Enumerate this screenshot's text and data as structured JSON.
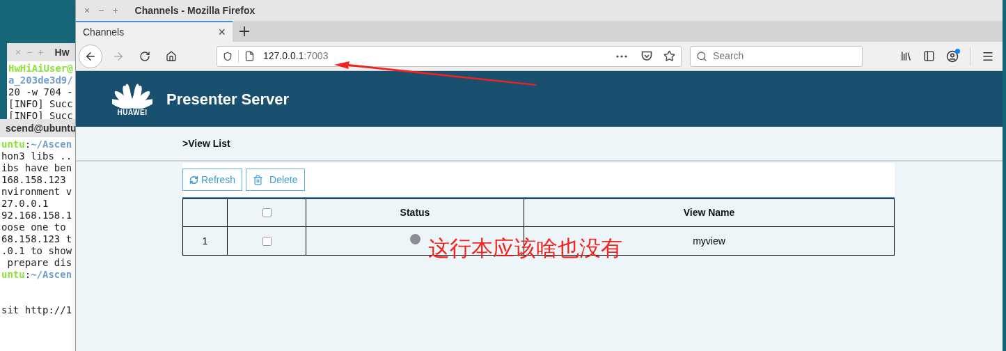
{
  "terminals": [
    {
      "title": "Hw",
      "lines": [
        {
          "parts": [
            {
              "text": "HwHiAiUser@",
              "kind": "user"
            }
          ]
        },
        {
          "parts": [
            {
              "text": "a_203de3d9/",
              "kind": "path"
            }
          ]
        },
        {
          "parts": [
            {
              "text": "20 -w 704 -",
              "kind": "plain"
            }
          ]
        },
        {
          "parts": [
            {
              "text": "[INFO] Succ",
              "kind": "plain"
            }
          ]
        },
        {
          "parts": [
            {
              "text": "[INFO] Succ",
              "kind": "plain"
            }
          ]
        }
      ]
    },
    {
      "title": "scend@ubuntu",
      "lines": [
        {
          "parts": [
            {
              "text": "untu",
              "kind": "user"
            },
            {
              "text": ":",
              "kind": "plain"
            },
            {
              "text": "~/Ascen",
              "kind": "path"
            }
          ]
        },
        {
          "parts": [
            {
              "text": "hon3 libs ..",
              "kind": "plain"
            }
          ]
        },
        {
          "parts": [
            {
              "text": "ibs have ben",
              "kind": "plain"
            }
          ]
        },
        {
          "parts": [
            {
              "text": "168.158.123",
              "kind": "plain"
            }
          ]
        },
        {
          "parts": [
            {
              "text": "nvironment v",
              "kind": "plain"
            }
          ]
        },
        {
          "parts": [
            {
              "text": "27.0.0.1",
              "kind": "plain"
            }
          ]
        },
        {
          "parts": [
            {
              "text": "92.168.158.1",
              "kind": "plain"
            }
          ]
        },
        {
          "parts": [
            {
              "text": "oose one to",
              "kind": "plain"
            }
          ]
        },
        {
          "parts": [
            {
              "text": "68.158.123 t",
              "kind": "plain"
            }
          ]
        },
        {
          "parts": [
            {
              "text": ".0.1 to show",
              "kind": "plain"
            }
          ]
        },
        {
          "parts": [
            {
              "text": " prepare dis",
              "kind": "plain"
            }
          ]
        },
        {
          "parts": [
            {
              "text": "untu",
              "kind": "user"
            },
            {
              "text": ":",
              "kind": "plain"
            },
            {
              "text": "~/Ascen",
              "kind": "path"
            }
          ]
        },
        {
          "kind": "blank"
        },
        {
          "kind": "blank"
        },
        {
          "parts": [
            {
              "text": "sit http://1",
              "kind": "plain"
            }
          ]
        }
      ]
    }
  ],
  "browser": {
    "window_title": "Channels - Mozilla Firefox",
    "window_controls": [
      "×",
      "−",
      "+"
    ],
    "tabs": [
      {
        "label": "Channels",
        "close": "×",
        "selected": true
      }
    ],
    "back_disabled": false,
    "forward_disabled": true,
    "url": {
      "host": "127.0.0.1",
      "port": ":7003"
    },
    "search": {
      "placeholder": "Search"
    },
    "account_notification": true
  },
  "page": {
    "logo_text": "HUAWEI",
    "title": "Presenter Server",
    "breadcrumb": ">View List",
    "buttons": [
      {
        "kind": "refresh",
        "label": "Refresh"
      },
      {
        "kind": "delete",
        "label": "Delete"
      }
    ],
    "table": {
      "columns": [
        {
          "kind": "index"
        },
        {
          "kind": "select",
          "checked": false
        },
        {
          "kind": "text",
          "label": "Status"
        },
        {
          "kind": "text",
          "label": "View Name"
        }
      ],
      "rows": [
        {
          "index": "1",
          "checked": false,
          "color": "#8a8e94",
          "view_name": "myview"
        }
      ]
    }
  },
  "annotation": {
    "text": "这行本应该啥也没有"
  }
}
